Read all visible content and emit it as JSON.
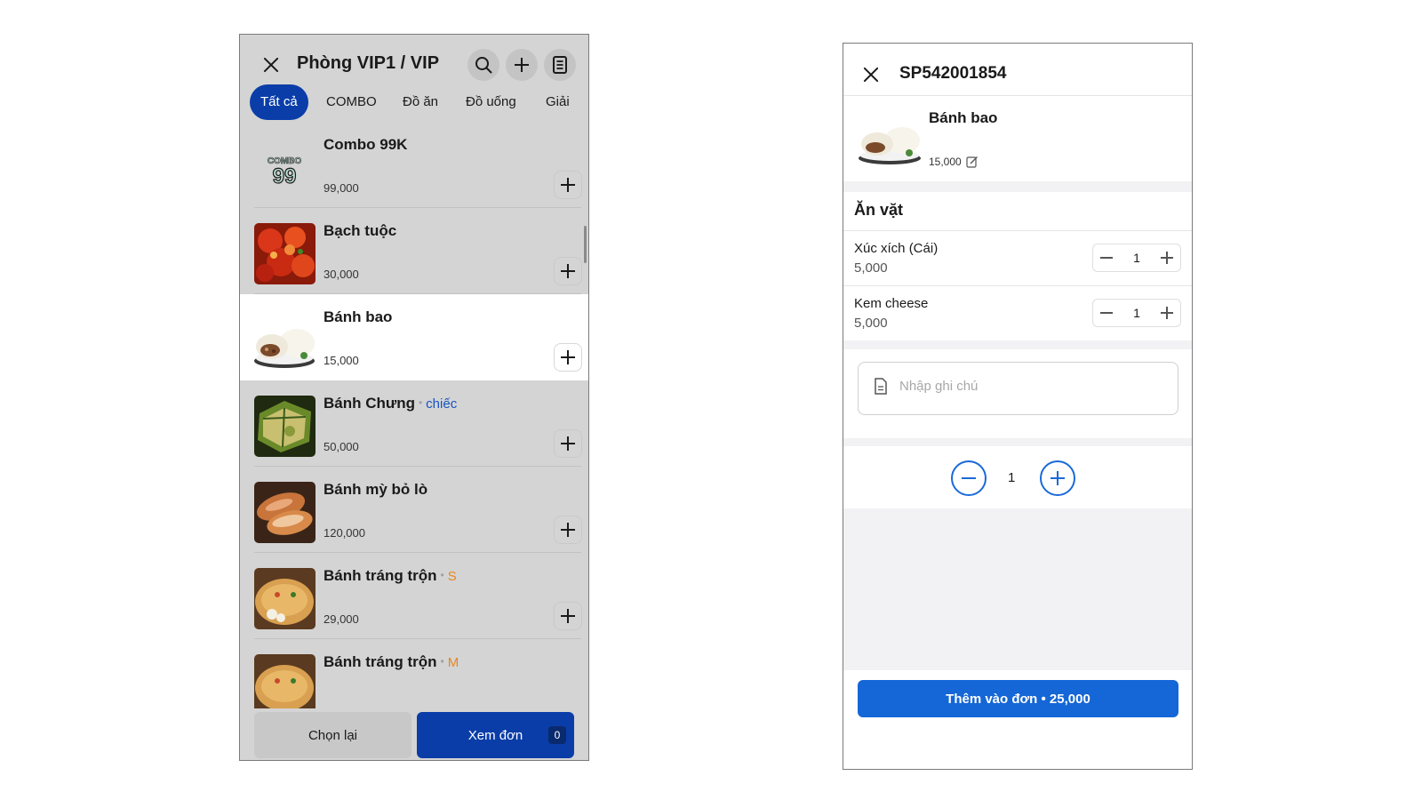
{
  "left": {
    "title": "Phòng VIP1 / VIP",
    "tabs": [
      "Tất cả",
      "COMBO",
      "Đồ ăn",
      "Đồ uống",
      "Giải"
    ],
    "items": [
      {
        "name": "Combo 99K",
        "price": "99,000"
      },
      {
        "name": "Bạch tuộc",
        "price": "30,000"
      },
      {
        "name": "Bánh bao",
        "price": "15,000"
      },
      {
        "name": "Bánh Chưng",
        "variant": "chiếc",
        "price": "50,000"
      },
      {
        "name": "Bánh mỳ bỏ lò",
        "price": "120,000"
      },
      {
        "name": "Bánh tráng trộn",
        "variant": "S",
        "price": "29,000"
      },
      {
        "name": "Bánh tráng trộn",
        "variant": "M",
        "price": ""
      }
    ],
    "footer": {
      "reset_label": "Chọn lại",
      "view_label": "Xem đơn",
      "badge": "0"
    },
    "logo_text": "COMBO 99"
  },
  "right": {
    "code": "SP542001854",
    "product": {
      "name": "Bánh bao",
      "price": "15,000"
    },
    "section_title": "Ăn vặt",
    "options": [
      {
        "name": "Xúc xích (Cái)",
        "price": "5,000",
        "qty": "1"
      },
      {
        "name": "Kem cheese",
        "price": "5,000",
        "qty": "1"
      }
    ],
    "note_placeholder": "Nhập ghi chú",
    "quantity": "1",
    "add_button": "Thêm vào đơn • 25,000"
  },
  "colors": {
    "primary_dark": "#0a3da8",
    "primary": "#1566d6",
    "variant_blue": "#1655c0",
    "variant_orange": "#e8871e"
  }
}
